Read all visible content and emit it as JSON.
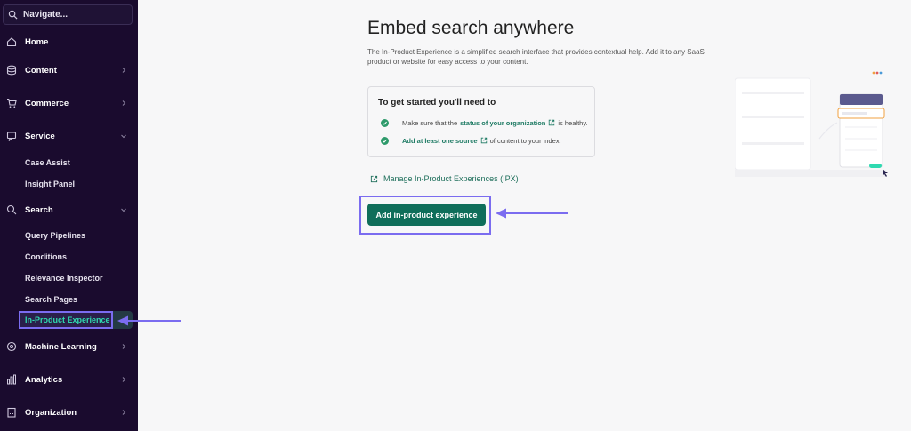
{
  "sidebar": {
    "search_placeholder": "Navigate...",
    "items": [
      {
        "label": "Home",
        "icon": "home-icon"
      },
      {
        "label": "Content",
        "icon": "database-icon"
      },
      {
        "label": "Commerce",
        "icon": "cart-icon"
      },
      {
        "label": "Service",
        "icon": "service-icon"
      },
      {
        "label": "Search",
        "icon": "search-icon"
      },
      {
        "label": "Machine Learning",
        "icon": "brain-icon"
      },
      {
        "label": "Analytics",
        "icon": "chart-icon"
      },
      {
        "label": "Organization",
        "icon": "building-icon"
      }
    ],
    "service_sub": [
      "Case Assist",
      "Insight Panel"
    ],
    "search_sub": [
      "Query Pipelines",
      "Conditions",
      "Relevance Inspector",
      "Search Pages"
    ],
    "active": "In-Product Experience"
  },
  "main": {
    "title": "Embed search anywhere",
    "description": "The In-Product Experience is a simplified search interface that provides contextual help. Add it to any SaaS product or website for easy access to your content.",
    "card": {
      "title": "To get started you'll need to",
      "req1": {
        "before": "Make sure that the",
        "link": "status of your organization",
        "after": "is healthy."
      },
      "req2": {
        "link": "Add at least one source",
        "after": "of content to your index."
      }
    },
    "manage_link": "Manage In-Product Experiences (IPX)",
    "add_button": "Add in-product experience"
  },
  "colors": {
    "sidebar_bg": "#1a0b2e",
    "accent_green": "#0f6e5a",
    "active_text": "#2fd9b0",
    "highlight": "#7b6cf0"
  }
}
